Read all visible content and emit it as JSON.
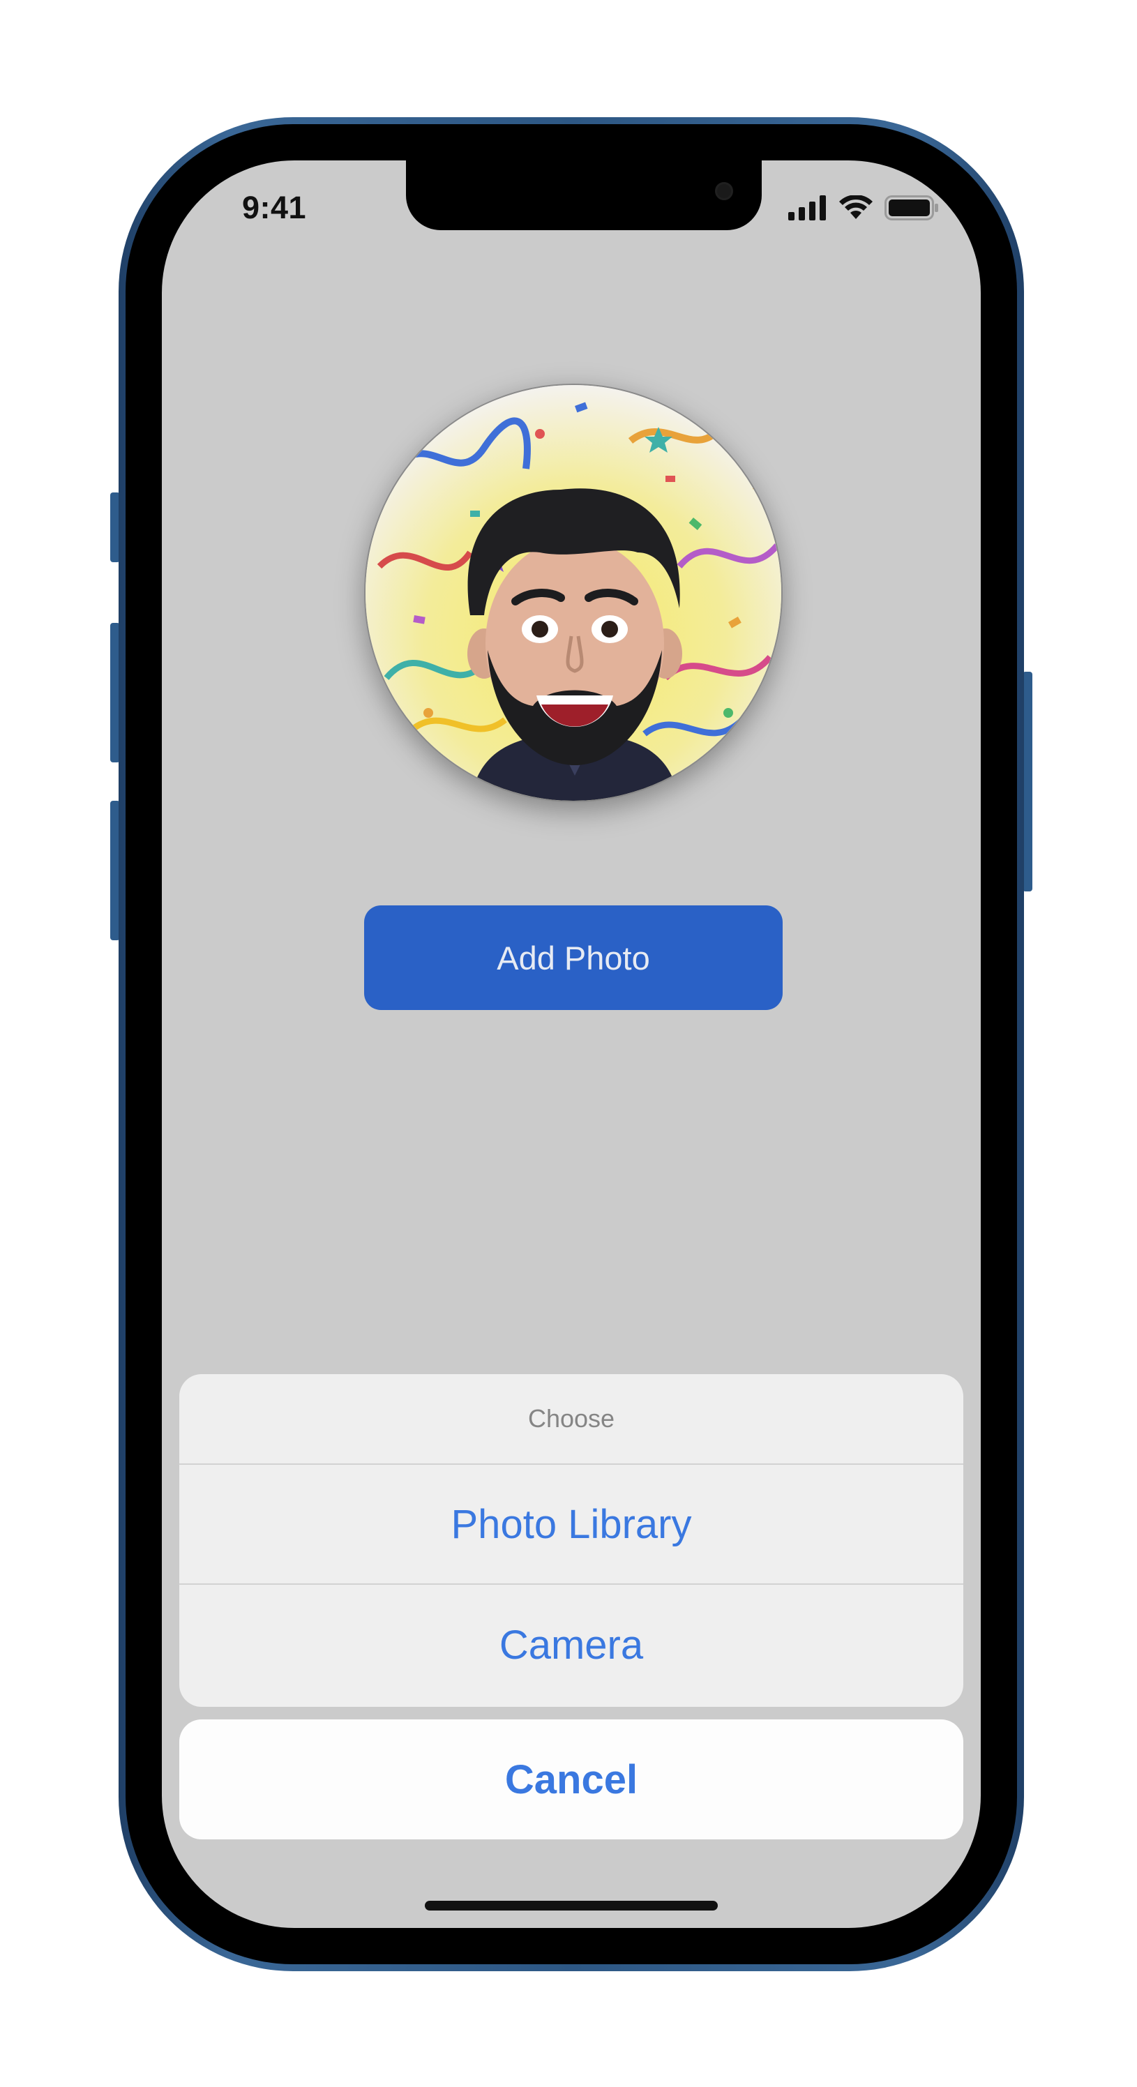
{
  "status_bar": {
    "time": "9:41",
    "icons": [
      "cellular-signal-icon",
      "wifi-icon",
      "battery-icon"
    ]
  },
  "profile": {
    "avatar": "memoji-avatar-with-confetti"
  },
  "add_photo_button": {
    "label": "Add Photo"
  },
  "action_sheet": {
    "title": "Choose",
    "options": [
      {
        "label": "Photo Library"
      },
      {
        "label": "Camera"
      }
    ],
    "cancel_label": "Cancel"
  },
  "colors": {
    "screen_dim_background": "#cbcbcb",
    "button_blue": "#2a61c6",
    "action_blue": "#3a78e0",
    "sheet_background": "#efefef",
    "cancel_background": "#fdfdfd",
    "phone_frame": "#2d5784"
  }
}
